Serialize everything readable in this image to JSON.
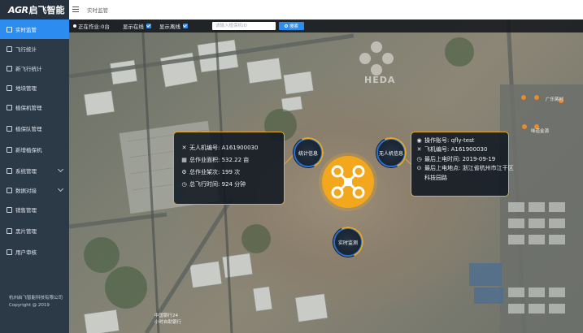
{
  "app": {
    "logo_mark": "AGR",
    "logo_text": "启飞智能"
  },
  "sidebar": {
    "items": [
      {
        "label": "实时监管",
        "active": true
      },
      {
        "label": "飞行统计"
      },
      {
        "label": "新飞行统计"
      },
      {
        "label": "地块管理"
      },
      {
        "label": "植保机管理"
      },
      {
        "label": "植保队管理"
      },
      {
        "label": "新增植保机"
      },
      {
        "label": "系统管理",
        "expandable": true
      },
      {
        "label": "数据对接",
        "expandable": true
      },
      {
        "label": "销售管理"
      },
      {
        "label": "黑片管理"
      },
      {
        "label": "用户审核"
      }
    ],
    "footer_company": "杭州启飞智能科技有限公司",
    "footer_copyright": "Copyright @ 2019"
  },
  "header": {
    "breadcrumb": "实时监管"
  },
  "controls": {
    "working_count": "正在作业:0台",
    "show_online": "显示在线",
    "show_offline": "显示离线",
    "search_placeholder": "请输入植保机ID",
    "search_button": "搜索"
  },
  "left_panel": {
    "rows": [
      "无人机编号: A161900030",
      "总作业面积: 532.22 亩",
      "总作业架次: 199 次",
      "总飞行时间: 924 分钟"
    ]
  },
  "right_panel": {
    "rows": [
      "操作账号: qfly-test",
      "飞机编号: A161900030",
      "最后上电时间: 2019-09-19",
      "最后上电地点: 浙江省杭州市江干区",
      "科技园路"
    ]
  },
  "circle_buttons": {
    "stats": "统计信息",
    "drone_info": "无人机信息",
    "live": "实时监测"
  },
  "map_labels": {
    "logo": "HEDA",
    "poi_1": "中国银行24",
    "poi_2": "小时自助银行",
    "poi_3": "味道金源",
    "poi_4": "广乐蒋村"
  },
  "colors": {
    "accent": "#2d8cf0",
    "sidebar_bg": "#2c3947",
    "panel_border": "#e5a92a",
    "hub": "#f2a71c"
  }
}
